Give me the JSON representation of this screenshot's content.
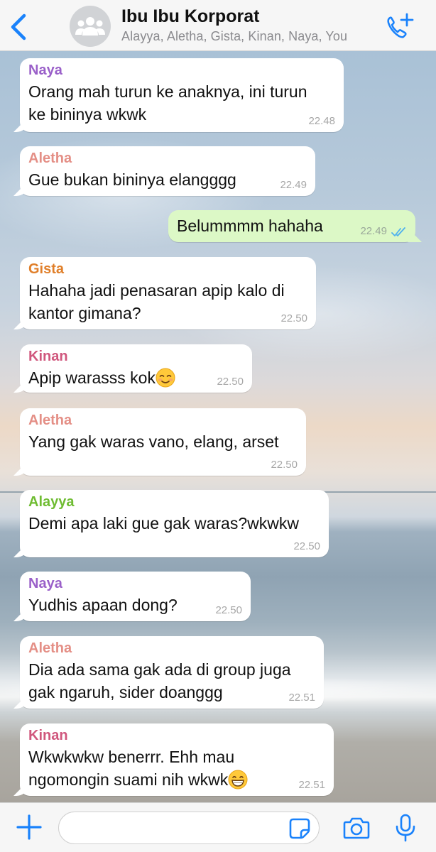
{
  "header": {
    "title": "Ibu Ibu Korporat",
    "members": "Alayya, Aletha, Gista, Kinan, Naya, You"
  },
  "colors": {
    "accent": "#1a82fb",
    "out_bubble": "#dcf8c6",
    "in_bubble": "#ffffff",
    "naya": "#9a60c9",
    "aletha": "#e48f86",
    "gista": "#e07f2a",
    "kinan": "#d0577d",
    "alayya": "#6fbc32",
    "read_ticks": "#4fb1ee"
  },
  "messages": [
    {
      "sender": "Naya",
      "text1": "Orang mah turun ke anaknya, ini turun",
      "text2": "ke bininya wkwk",
      "time": "22.48"
    },
    {
      "sender": "Aletha",
      "text1": "Gue bukan bininya elangggg",
      "time": "22.49"
    },
    {
      "sender": "You",
      "text1": "Belummmm hahaha",
      "time": "22.49",
      "read": true
    },
    {
      "sender": "Gista",
      "text1": "Hahaha jadi penasaran apip kalo di",
      "text2": "kantor gimana?",
      "time": "22.50"
    },
    {
      "sender": "Kinan",
      "text1": "Apip warasss kok",
      "emoji": "smiling-face-icon",
      "time": "22.50"
    },
    {
      "sender": "Aletha",
      "text1": "Yang gak waras vano, elang, arset",
      "time": "22.50"
    },
    {
      "sender": "Alayya",
      "text1": "Demi apa laki gue gak waras?wkwkw",
      "time": "22.50"
    },
    {
      "sender": "Naya",
      "text1": "Yudhis apaan dong?",
      "time": "22.50"
    },
    {
      "sender": "Aletha",
      "text1": "Dia ada sama gak ada di group juga",
      "text2": "gak ngaruh, sider doanggg",
      "time": "22.51"
    },
    {
      "sender": "Kinan",
      "text1": "Wkwkwkw benerrr. Ehh mau",
      "text2": "ngomongin suami nih wkwk",
      "emoji": "grinning-face-icon",
      "time": "22.51"
    }
  ],
  "input": {
    "placeholder": ""
  }
}
